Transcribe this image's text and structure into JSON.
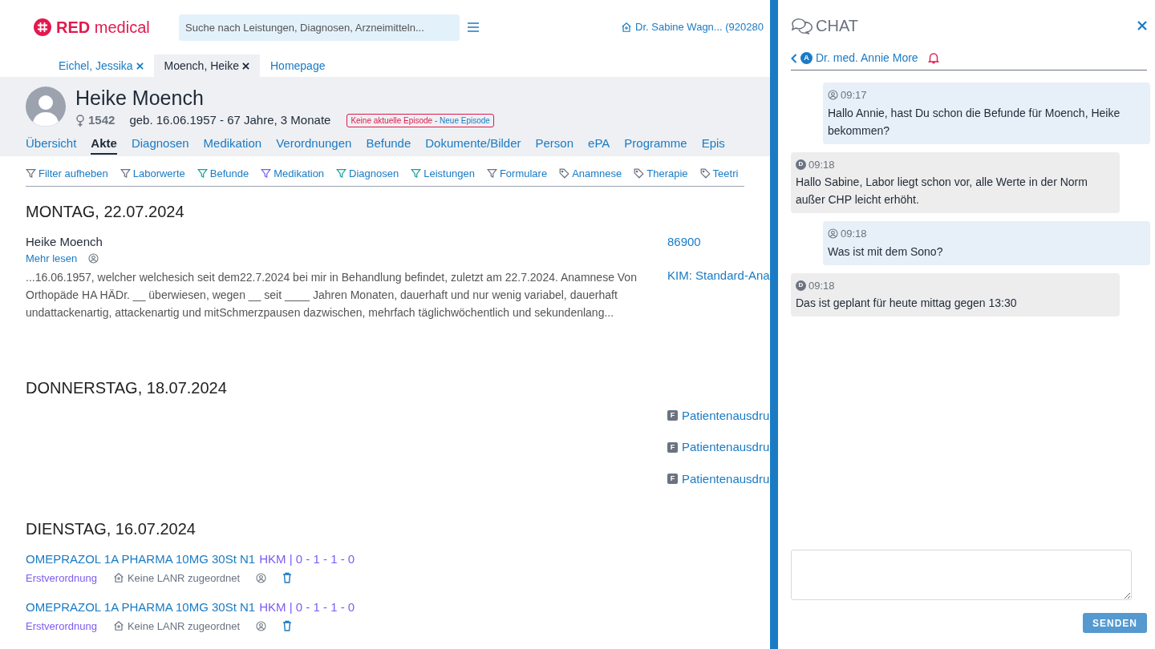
{
  "header": {
    "logo_bold": "RED",
    "logo_light": "medical",
    "search": {
      "placeholder": "Suche nach Leistungen, Diagnosen, Arzneimitteln..."
    },
    "user": "Dr. Sabine Wagn... (920280"
  },
  "patient_tabs": [
    {
      "label": "Eichel, Jessika",
      "closable": true,
      "selected": false
    },
    {
      "label": "Moench, Heike",
      "closable": true,
      "selected": true
    },
    {
      "label": "Homepage",
      "closable": false,
      "selected": false
    }
  ],
  "patient": {
    "name": "Heike Moench",
    "number": "1542",
    "birth": "geb. 16.06.1957 - 67 Jahre, 3 Monate",
    "episode_warning": "Keine aktuelle Episode -",
    "episode_link": "Neue Episode"
  },
  "nav": [
    {
      "label": "Übersicht",
      "selected": false
    },
    {
      "label": "Akte",
      "selected": true
    },
    {
      "label": "Diagnosen",
      "selected": false
    },
    {
      "label": "Medikation",
      "selected": false
    },
    {
      "label": "Verordnungen",
      "selected": false
    },
    {
      "label": "Befunde",
      "selected": false
    },
    {
      "label": "Dokumente/Bilder",
      "selected": false
    },
    {
      "label": "Person",
      "selected": false
    },
    {
      "label": "ePA",
      "selected": false
    },
    {
      "label": "Programme",
      "selected": false
    },
    {
      "label": "Epis",
      "selected": false
    }
  ],
  "filters": [
    {
      "label": "Filter aufheben",
      "kind": "filter",
      "color": "#6b7280"
    },
    {
      "label": "Laborwerte",
      "kind": "filter",
      "color": "#6b7280"
    },
    {
      "label": "Befunde",
      "kind": "filter",
      "color": "#14a39a"
    },
    {
      "label": "Medikation",
      "kind": "filter",
      "color": "#7c5cf0"
    },
    {
      "label": "Diagnosen",
      "kind": "filter",
      "color": "#14a39a"
    },
    {
      "label": "Leistungen",
      "kind": "filter",
      "color": "#14a39a"
    },
    {
      "label": "Formulare",
      "kind": "filter",
      "color": "#6b7280"
    },
    {
      "label": "Anamnese",
      "kind": "tag",
      "color": "#6b7280"
    },
    {
      "label": "Therapie",
      "kind": "tag",
      "color": "#6b7280"
    },
    {
      "label": "Teetri",
      "kind": "tag",
      "color": "#6b7280"
    }
  ],
  "days": [
    {
      "date": "MONTAG, 22.07.2024",
      "entries": [
        {
          "kind": "note",
          "author": "Heike Moench",
          "more": "Mehr lesen",
          "text": "...16.06.1957, welcher welchesich seit dem22.7.2024 bei mir in Behandlung befindet, zuletzt am 22.7.2024. Anamnese Von Orthopäde HA HÄDr. __ überwiesen, wegen __ seit ____ Jahren Monaten, dauerhaft und nur wenig variabel, dauerhaft undattackenartig, attackenartig und mitSchmerzpausen dazwischen, mehrfach täglichwöchentlich und sekundenlang..."
        }
      ],
      "side": [
        {
          "kind": "link",
          "label": "86900"
        },
        {
          "kind": "link",
          "label": "KIM: Standard-Ana"
        }
      ]
    },
    {
      "date": "DONNERSTAG, 18.07.2024",
      "side": [
        {
          "kind": "form",
          "badge": "F",
          "label": "Patientenausdru"
        },
        {
          "kind": "form",
          "badge": "F",
          "label": "Patientenausdru"
        },
        {
          "kind": "form",
          "badge": "F",
          "label": "Patientenausdru"
        }
      ]
    },
    {
      "date": "DIENSTAG, 16.07.2024",
      "entries": [
        {
          "kind": "medication",
          "name": "OMEPRAZOL 1A PHARMA 10MG 30St N1",
          "dosage": "HKM | 0 - 1 - 1 - 0",
          "type": "Erstverordnung",
          "lanr": "Keine LANR zugeordnet"
        },
        {
          "kind": "medication",
          "name": "OMEPRAZOL 1A PHARMA 10MG 30St N1",
          "dosage": "HKM | 0 - 1 - 1 - 0",
          "type": "Erstverordnung",
          "lanr": "Keine LANR zugeordnet"
        }
      ]
    }
  ],
  "chat": {
    "title": "CHAT",
    "contact_initial": "A",
    "contact": "Dr. med. Annie More",
    "messages": [
      {
        "kind": "sent",
        "time": "09:17",
        "text": "Hallo Annie, hast Du schon die Befunde für Moench, Heike bekommen?"
      },
      {
        "kind": "received",
        "initial": "D",
        "time": "09:18",
        "text": "Hallo Sabine, Labor liegt schon vor, alle Werte in der Norm außer CHP leicht erhöht."
      },
      {
        "kind": "sent",
        "time": "09:18",
        "text": "Was ist mit dem Sono?"
      },
      {
        "kind": "received",
        "initial": "D",
        "time": "09:18",
        "text": "Das ist geplant für heute mittag gegen 13:30"
      }
    ],
    "send": "SENDEN"
  }
}
